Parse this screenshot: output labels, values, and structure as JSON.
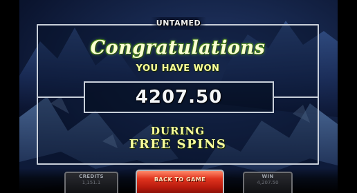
{
  "game": {
    "logo_text": "UNTAMED"
  },
  "dialog": {
    "headline": "Congratulations",
    "subheadline": "YOU HAVE WON",
    "amount": "4207.50",
    "during_text": "DURING",
    "feature_text": "FREE SPINS"
  },
  "bottom_bar": {
    "credits_label": "CREDITS",
    "credits_value": "1,151.1",
    "back_button_label": "BACK TO GAME",
    "win_label": "WIN",
    "win_value": "4,207.50"
  },
  "colors": {
    "headline_fill": "#fbffd2",
    "headline_outline": "#4a8a18",
    "accent_text": "#f9ff9c",
    "frame_border": "#c9d0da",
    "button_red": "#e0341e",
    "sky": "#16264b"
  }
}
